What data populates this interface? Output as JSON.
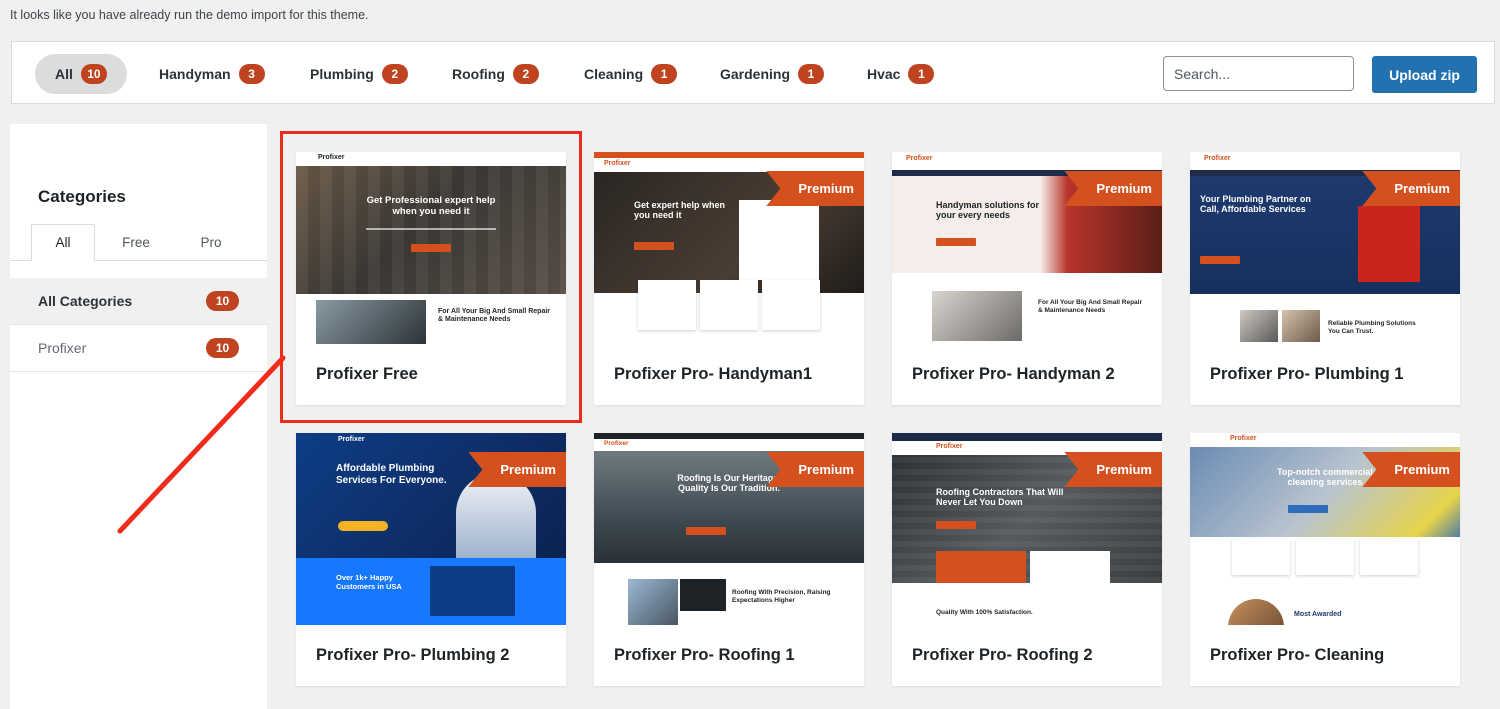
{
  "notice": "It looks like you have already run the demo import for this theme.",
  "filters": [
    {
      "label": "All",
      "count": "10"
    },
    {
      "label": "Handyman",
      "count": "3"
    },
    {
      "label": "Plumbing",
      "count": "2"
    },
    {
      "label": "Roofing",
      "count": "2"
    },
    {
      "label": "Cleaning",
      "count": "1"
    },
    {
      "label": "Gardening",
      "count": "1"
    },
    {
      "label": "Hvac",
      "count": "1"
    }
  ],
  "search": {
    "placeholder": "Search..."
  },
  "upload_label": "Upload zip",
  "sidebar": {
    "heading": "Categories",
    "tabs": [
      "All",
      "Free",
      "Pro"
    ],
    "categories": [
      {
        "label": "All Categories",
        "count": "10"
      },
      {
        "label": "Profixer",
        "count": "10"
      }
    ]
  },
  "ribbon_label": "Premium",
  "cards": [
    {
      "title": "Profixer Free",
      "hero": "Get Professional expert help when you need it",
      "sub": "For All Your Big And Small Repair & Maintenance Needs",
      "brand": "Profixer"
    },
    {
      "title": "Profixer Pro- Handyman1",
      "hero": "Get expert help when you need it",
      "sub": "",
      "brand": "Profixer"
    },
    {
      "title": "Profixer Pro- Handyman 2",
      "hero": "Handyman solutions for your every needs",
      "sub": "For All Your Big And Small Repair & Maintenance Needs",
      "brand": "Profixer"
    },
    {
      "title": "Profixer Pro- Plumbing 1",
      "hero": "Your Plumbing Partner on Call, Affordable Services",
      "sub": "Reliable Plumbing Solutions You Can Trust.",
      "brand": "Profixer"
    },
    {
      "title": "Profixer Pro- Plumbing 2",
      "hero": "Affordable Plumbing Services For Everyone.",
      "sub": "Over 1k+ Happy Customers in USA",
      "brand": "Profixer"
    },
    {
      "title": "Profixer Pro- Roofing 1",
      "hero": "Roofing Is Our Heritage, Quality Is Our Tradition.",
      "sub": "Roofing With Precision, Raising Expectations Higher",
      "brand": "Profixer"
    },
    {
      "title": "Profixer Pro- Roofing 2",
      "hero": "Roofing Contractors That Will Never Let You Down",
      "sub": "Quality With 100% Satisfaction.",
      "brand": "Profixer"
    },
    {
      "title": "Profixer Pro- Cleaning",
      "hero": "Top-notch commercial cleaning services",
      "sub": "Most Awarded",
      "brand": "Profixer"
    }
  ]
}
